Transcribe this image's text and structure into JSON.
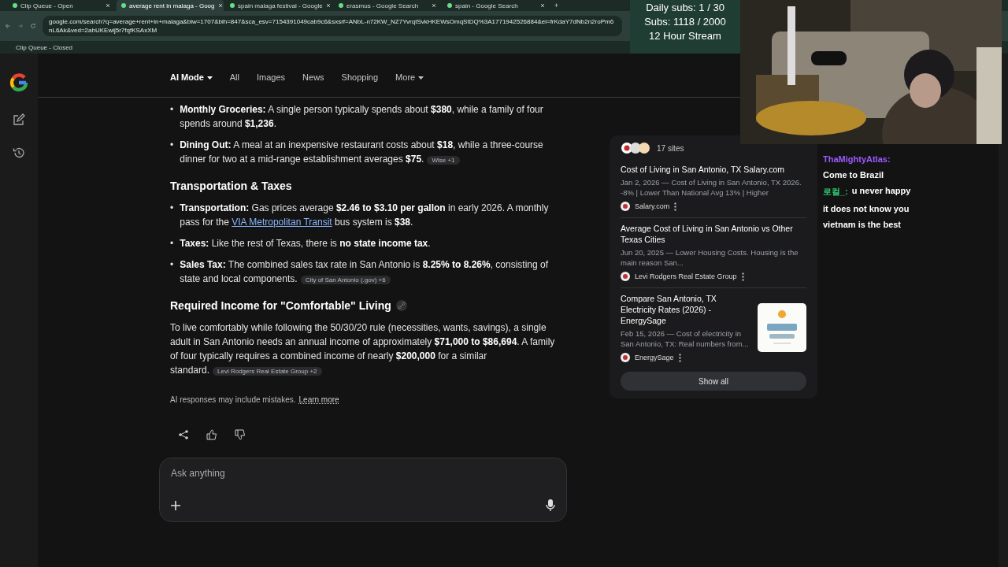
{
  "browser": {
    "tabs": [
      {
        "label": "Clip Queue - Open",
        "selected": false
      },
      {
        "label": "average rent in malaga - Goog",
        "selected": true
      },
      {
        "label": "spain malaga festival - Google",
        "selected": false
      },
      {
        "label": "erasmus - Google Search",
        "selected": false
      },
      {
        "label": "spain - Google Search",
        "selected": false
      }
    ],
    "new_tab": "+",
    "url": "google.com/search?q=average+rent+in+malaga&biw=1707&bih=847&sca_esv=7154391049cab9c6&sxsrf=ANbL-n72KW_NZ7YvrqtSvkHKEWsOmqStDQ%3A1771942526884&ei=frKdaY7dNb2n2roPm6nL6Ak&ved=2ahUKEwij5r7fqfKSAxXM",
    "bookmarks": [
      {
        "label": "Clip Queue - Closed"
      }
    ]
  },
  "stream_overlay": {
    "lines": [
      "Daily subs: 1 / 30",
      "Subs: 1118 / 2000",
      "12 Hour Stream"
    ]
  },
  "search_tabs": [
    {
      "label": "AI Mode",
      "selected": true,
      "dropdown": true
    },
    {
      "label": "All",
      "selected": false,
      "dropdown": false
    },
    {
      "label": "Images",
      "selected": false,
      "dropdown": false
    },
    {
      "label": "News",
      "selected": false,
      "dropdown": false
    },
    {
      "label": "Shopping",
      "selected": false,
      "dropdown": false
    },
    {
      "label": "More",
      "selected": false,
      "dropdown": true
    }
  ],
  "answer": [
    {
      "kind": "bullets",
      "marker": "•",
      "items": [
        {
          "parts": [
            {
              "kind": "text",
              "text": "**Monthly Groceries:** A single person typically spends about **$380**, while a family of four spends around **$1,236**."
            }
          ]
        },
        {
          "parts": [
            {
              "kind": "text",
              "text": "**Dining Out:** A meal at an inexpensive restaurant costs about **$18**, while a three-course dinner for two at a mid-range establishment averages **$75**."
            }
          ],
          "cite": "Wise +1"
        }
      ]
    },
    {
      "kind": "heading",
      "text": "Transportation & Taxes"
    },
    {
      "kind": "bullets",
      "marker": "•",
      "items": [
        {
          "parts": [
            {
              "kind": "text",
              "text": "**Transportation:** Gas prices average **$2.46 to $3.10 per gallon** in early 2026. A monthly pass for the "
            },
            {
              "kind": "link",
              "text": "VIA Metropolitan Transit"
            },
            {
              "kind": "text",
              "text": " bus system is **$38**."
            }
          ]
        },
        {
          "parts": [
            {
              "kind": "text",
              "text": "**Taxes:** Like the rest of Texas, there is **no state income tax**."
            }
          ]
        },
        {
          "parts": [
            {
              "kind": "text",
              "text": "**Sales Tax:** The combined sales tax rate in San Antonio is **8.25% to 8.26%**, consisting of state and local components."
            }
          ],
          "cite": "City of San Antonio (.gov) +6"
        }
      ]
    },
    {
      "kind": "heading",
      "text": "Required Income for \"Comfortable\" Living",
      "link_icon": true
    },
    {
      "kind": "paragraph",
      "text": "To live comfortably while following the 50/30/20 rule (necessities, wants, savings), a single adult in San Antonio needs an annual income of approximately **$71,000 to $86,694**. A family of four typically requires a combined income of nearly **$200,000** for a similar standard.",
      "cite": "Levi Rodgers Real Estate Group +2"
    }
  ],
  "disclaimer": {
    "text": "AI responses may include mistakes.",
    "link": "Learn more"
  },
  "prompt": {
    "placeholder": "Ask anything"
  },
  "sources": {
    "count": "17 sites",
    "items": [
      {
        "title": "Cost of Living in San Antonio, TX Salary.com",
        "snippet": "Jan 2, 2026 — Cost of Living in San Antonio, TX 2026. -8% | Lower Than National Avg 13% | Higher",
        "source": "Salary.com",
        "thumbnail": false
      },
      {
        "title": "Average Cost of Living in San Antonio vs Other Texas Cities",
        "snippet": "Jun 20, 2025 — Lower Housing Costs. Housing is the main reason San...",
        "source": "Levi Rodgers Real Estate Group",
        "thumbnail": false
      },
      {
        "title": "Compare San Antonio, TX Electricity Rates (2026) - EnergySage",
        "snippet": "Feb 15, 2026 — Cost of electricity in San Antonio, TX: Real numbers from...",
        "source": "EnergySage",
        "thumbnail": true
      }
    ],
    "show_all": "Show all"
  },
  "chat": [
    {
      "user": "ThaMightyAtlas:",
      "color": "#9b5cff"
    },
    {
      "text": "Come to Brazil"
    },
    {
      "user": "로컬_:",
      "color": "#2ecc71",
      "text": "u never happy"
    },
    {
      "text": "it does not know you"
    },
    {
      "text": "vietnam is the best"
    }
  ]
}
